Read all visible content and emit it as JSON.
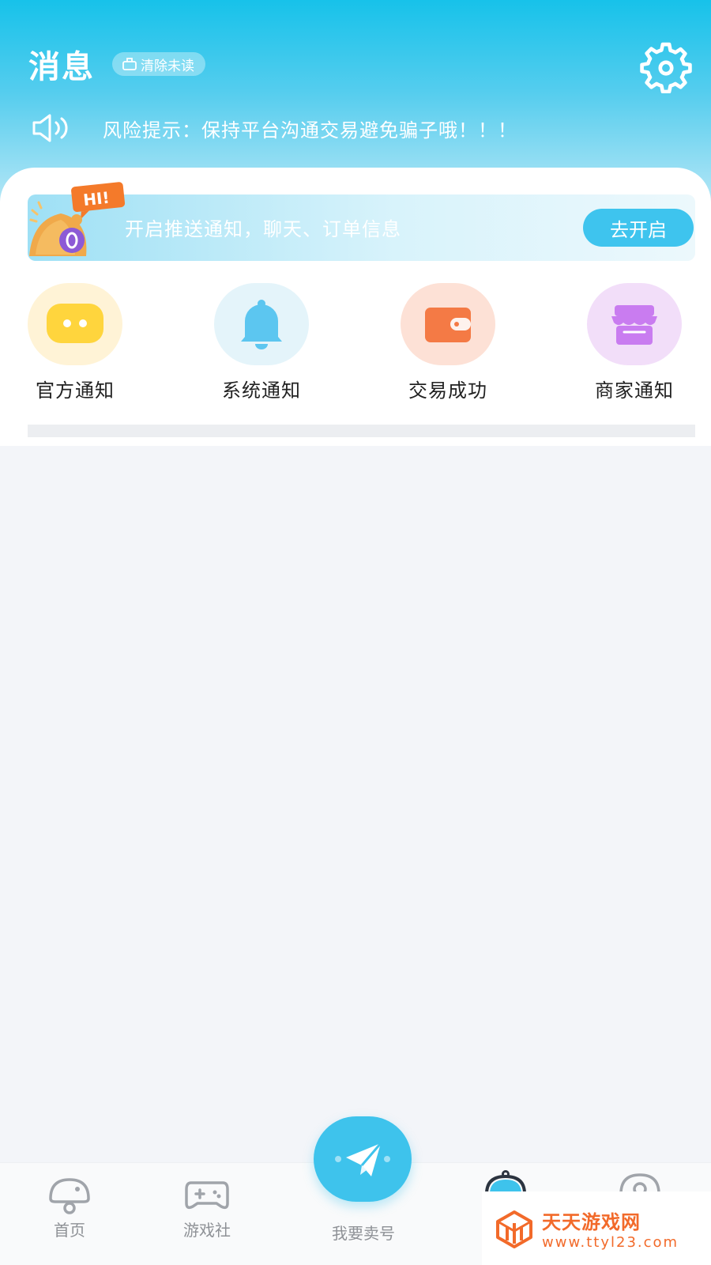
{
  "header": {
    "title": "消息",
    "clear_unread_label": "清除未读",
    "settings_icon": "gear-icon"
  },
  "notice": {
    "icon": "speaker-icon",
    "text": "风险提示：保持平台沟通交易避免骗子哦！！！"
  },
  "push_banner": {
    "badge_text": "HI!",
    "text": "开启推送通知，聊天、订单信息",
    "button_label": "去开启"
  },
  "categories": [
    {
      "label": "官方通知",
      "icon": "chat-bubble-icon",
      "color": "#ffd53d",
      "bg": "#fff3d6"
    },
    {
      "label": "系统通知",
      "icon": "bell-icon",
      "color": "#5cc6f0",
      "bg": "#e4f4fa"
    },
    {
      "label": "交易成功",
      "icon": "wallet-icon",
      "color": "#f47a45",
      "bg": "#fde1d6"
    },
    {
      "label": "商家通知",
      "icon": "store-icon",
      "color": "#c97cf0",
      "bg": "#f2def9"
    }
  ],
  "tabbar": {
    "tabs": [
      {
        "label": "首页",
        "icon": "home-icon"
      },
      {
        "label": "游戏社",
        "icon": "gamepad-icon"
      },
      {
        "label": "我要卖号",
        "icon": "send-icon"
      }
    ]
  },
  "watermark": {
    "title": "天天游戏网",
    "url": "www.ttyl23.com"
  },
  "colors": {
    "accent": "#3ec3ec",
    "watermark": "#f26a2a"
  }
}
